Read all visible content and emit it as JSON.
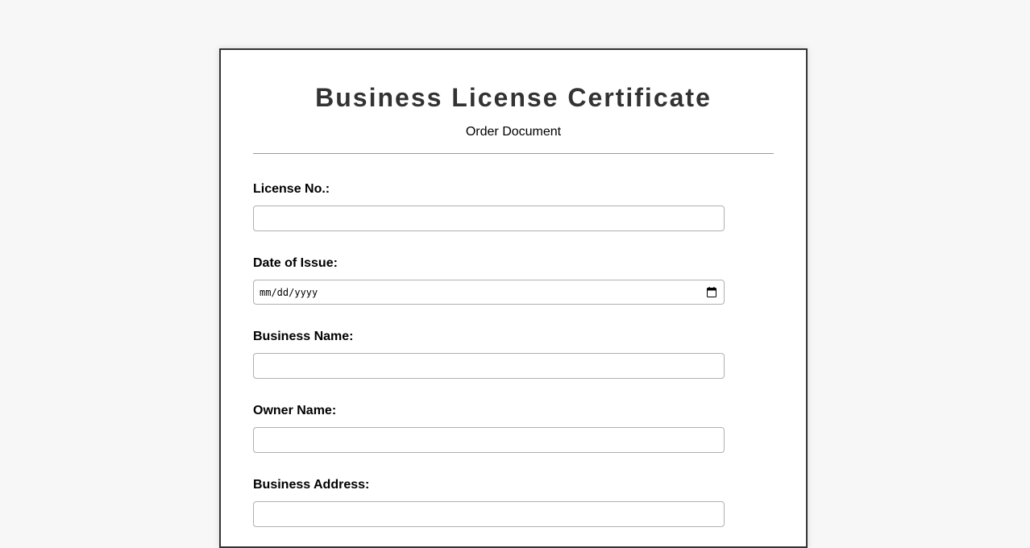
{
  "header": {
    "title": "Business License Certificate",
    "subtitle": "Order Document"
  },
  "form": {
    "license_no": {
      "label": "License No.:",
      "value": ""
    },
    "date_of_issue": {
      "label": "Date of Issue:",
      "placeholder": "mm/dd/yyyy",
      "icon": "calendar-icon"
    },
    "business_name": {
      "label": "Business Name:",
      "value": ""
    },
    "owner_name": {
      "label": "Owner Name:",
      "value": ""
    },
    "business_address": {
      "label": "Business Address:",
      "value": ""
    }
  },
  "colors": {
    "page_background": "#f7f7f7",
    "card_background": "#ffffff",
    "card_border": "#333333",
    "title_text": "#333333",
    "input_border": "#b0b0b0"
  }
}
